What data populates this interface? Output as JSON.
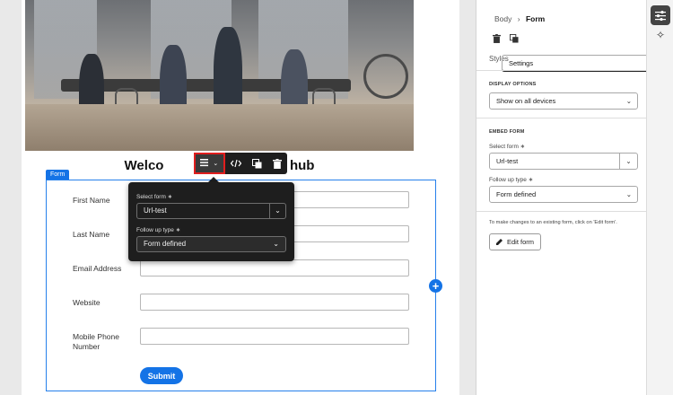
{
  "canvas": {
    "heading": "Welcome to our marketing hub",
    "heading_visible_left": "Welco",
    "heading_visible_right": "ng hub",
    "form_tag": "Form",
    "form_fields": [
      {
        "label": "First Name"
      },
      {
        "label": "Last Name"
      },
      {
        "label": "Email Address"
      },
      {
        "label": "Website"
      },
      {
        "label": "Mobile Phone Number"
      }
    ],
    "submit_label": "Submit",
    "add_symbol": "+"
  },
  "toolbar": {
    "icons": [
      "layout-icon",
      "code-icon",
      "duplicate-icon",
      "trash-icon"
    ]
  },
  "popover": {
    "select_form_label": "Select form ∗",
    "select_form_value": "Url-test",
    "follow_up_label": "Follow up type ∗",
    "follow_up_value": "Form defined"
  },
  "panel": {
    "breadcrumb_parent": "Body",
    "breadcrumb_current": "Form",
    "tabs": [
      {
        "label": "Settings",
        "selected": true
      },
      {
        "label": "Styles",
        "selected": false
      }
    ],
    "display_options_title": "DISPLAY OPTIONS",
    "display_options_value": "Show on all devices",
    "embed_form_title": "EMBED FORM",
    "select_form_label": "Select form ∗",
    "select_form_value": "Url-test",
    "follow_up_label": "Follow up type ∗",
    "follow_up_value": "Form defined",
    "note": "To make changes to an existing form, click on 'Edit form'.",
    "edit_button": "Edit form"
  },
  "colors": {
    "accent": "#1473e6",
    "toolbar_bg": "#1e1e1e",
    "highlight_border": "#e01e1e"
  }
}
